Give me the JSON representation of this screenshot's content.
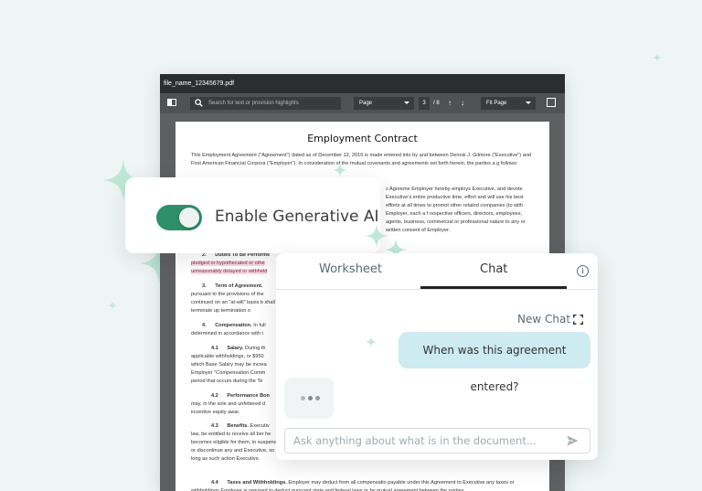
{
  "viewer": {
    "filename": "file_name_12345679.pdf",
    "search_placeholder": "Search for text or provision highlights",
    "page_mode": "Page",
    "page_current": "3",
    "page_total": "/ 8",
    "zoom_mode": "Fit Page"
  },
  "document": {
    "title": "Employment Contract",
    "intro": "This Employment Agreement (\"Agreement\") dated as of December 12, 2016 is made entered into by and between Dennis J. Gilmore (\"Executive\") and First American Financial Corpora (\"Employer\"). In consideration of the mutual covenants and agreements set forth herein, the parties a g follows:",
    "right_para": "s Agreeme Employer hereby employs Executive, and devote Executive's entire productive time, effort and will use his best efforts at all times to promot other related companies (to with Employer, each a f respective officers, directors, employees, agents, business, commercial or professional nature to any or written consent of Employer.",
    "sec2_num": "2.",
    "sec2_title": "Duties To Be Performe",
    "sec2_line1": "pledged or hypothecated or othe",
    "sec2_line2": "unreasonably delayed or withheld",
    "sec3_num": "3.",
    "sec3_title": "Term of Agreement.",
    "sec3_text": "pursuant to the provisions of the continued on an \"at-will\" basis b shall terminate up termination o",
    "sec4_num": "4.",
    "sec4_title": "Compensation.",
    "sec4_text": "In full determined in accordance with t",
    "sec41_num": "4.1",
    "sec41_title": "Salary.",
    "sec41_text": "During th applicable withholdings, or $950 which Base Salary may be increa Employer \"Compensation Comm period that occurs during the Te",
    "sec42_num": "4.2",
    "sec42_title": "Performance Bon",
    "sec42_text": "may, in the sole and unfettered d incentive equity awar.",
    "sec43_num": "4.3",
    "sec43_title": "Benefits.",
    "sec43_text": "Executiv law, be entitled to receive all ber he becomes eligible for them, in suspend or discontinue any and Executive, so long as such action Executive.",
    "sec44_num": "4.4",
    "sec44_title": "Taxes and Withholdings.",
    "sec44_text": "Employer may deduct from all compensatio payable under this Agreement to Executive any taxes or withholdings Employer is required to deduct pursuant state and federal laws or by mutual agreement between the parties."
  },
  "gen_ai": {
    "label": "Enable Generative AI",
    "enabled": true,
    "toggle_color": "#2f8f6a"
  },
  "chat": {
    "tabs": [
      {
        "label": "Worksheet",
        "active": false
      },
      {
        "label": "Chat",
        "active": true
      }
    ],
    "new_chat_label": "New Chat",
    "messages": [
      {
        "role": "user",
        "text": "When was this agreement entered?"
      }
    ],
    "assistant_typing": true,
    "input_placeholder": "Ask anything about what is in the document...",
    "bubble_color": "#cdebf0"
  }
}
